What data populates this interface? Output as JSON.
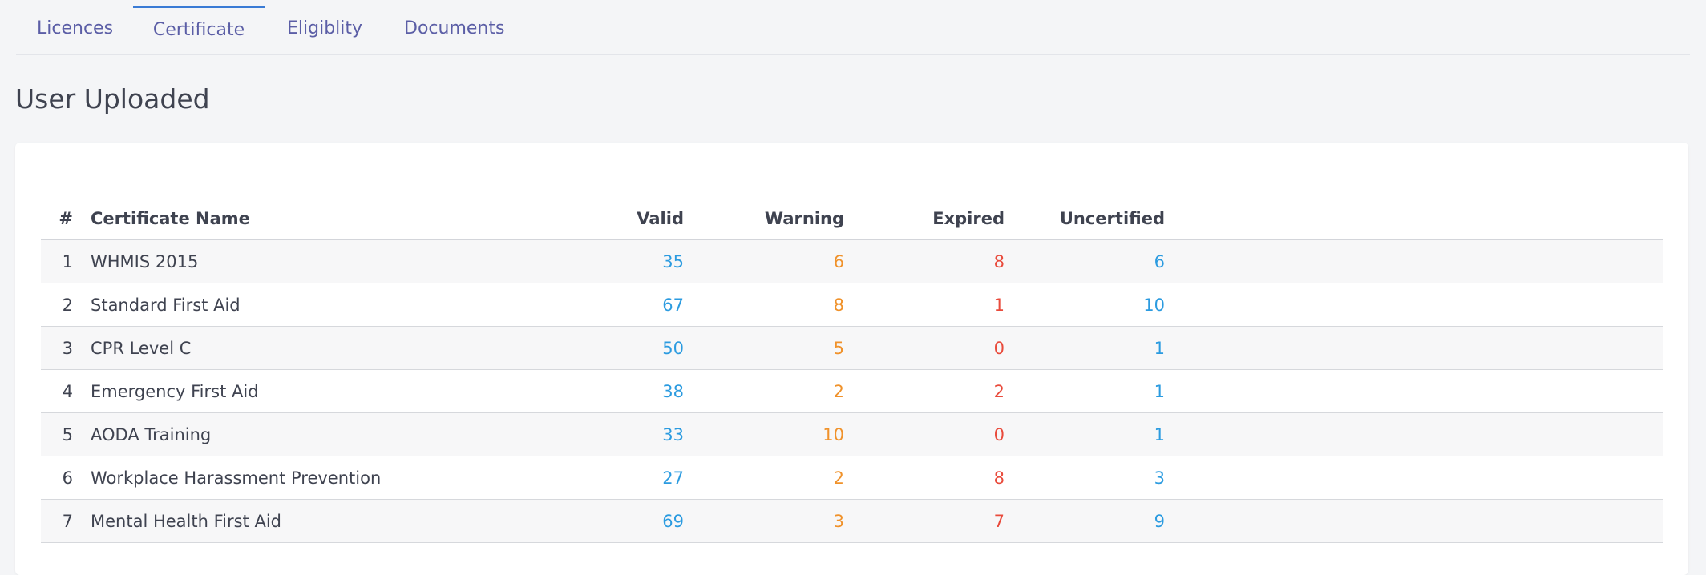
{
  "tabs": [
    {
      "label": "Licences",
      "active": false
    },
    {
      "label": "Certificate",
      "active": true
    },
    {
      "label": "Eligiblity",
      "active": false
    },
    {
      "label": "Documents",
      "active": false
    }
  ],
  "section_title": "User Uploaded",
  "table": {
    "headers": {
      "index": "#",
      "name": "Certificate Name",
      "valid": "Valid",
      "warning": "Warning",
      "expired": "Expired",
      "uncertified": "Uncertified"
    },
    "rows": [
      {
        "index": "1",
        "name": "WHMIS 2015",
        "valid": "35",
        "warning": "6",
        "expired": "8",
        "uncertified": "6"
      },
      {
        "index": "2",
        "name": "Standard First Aid",
        "valid": "67",
        "warning": "8",
        "expired": "1",
        "uncertified": "10"
      },
      {
        "index": "3",
        "name": "CPR Level C",
        "valid": "50",
        "warning": "5",
        "expired": "0",
        "uncertified": "1"
      },
      {
        "index": "4",
        "name": "Emergency First Aid",
        "valid": "38",
        "warning": "2",
        "expired": "2",
        "uncertified": "1"
      },
      {
        "index": "5",
        "name": "AODA Training",
        "valid": "33",
        "warning": "10",
        "expired": "0",
        "uncertified": "1"
      },
      {
        "index": "6",
        "name": "Workplace Harassment Prevention",
        "valid": "27",
        "warning": "2",
        "expired": "8",
        "uncertified": "3"
      },
      {
        "index": "7",
        "name": "Mental Health First Aid",
        "valid": "69",
        "warning": "3",
        "expired": "7",
        "uncertified": "9"
      }
    ]
  },
  "colors": {
    "tab_text": "#5b5ea6",
    "tab_active_indicator": "#3a7bd5",
    "valid": "#2b9be0",
    "warning": "#f0922b",
    "expired": "#e94b3c",
    "uncertified": "#2b9be0"
  }
}
